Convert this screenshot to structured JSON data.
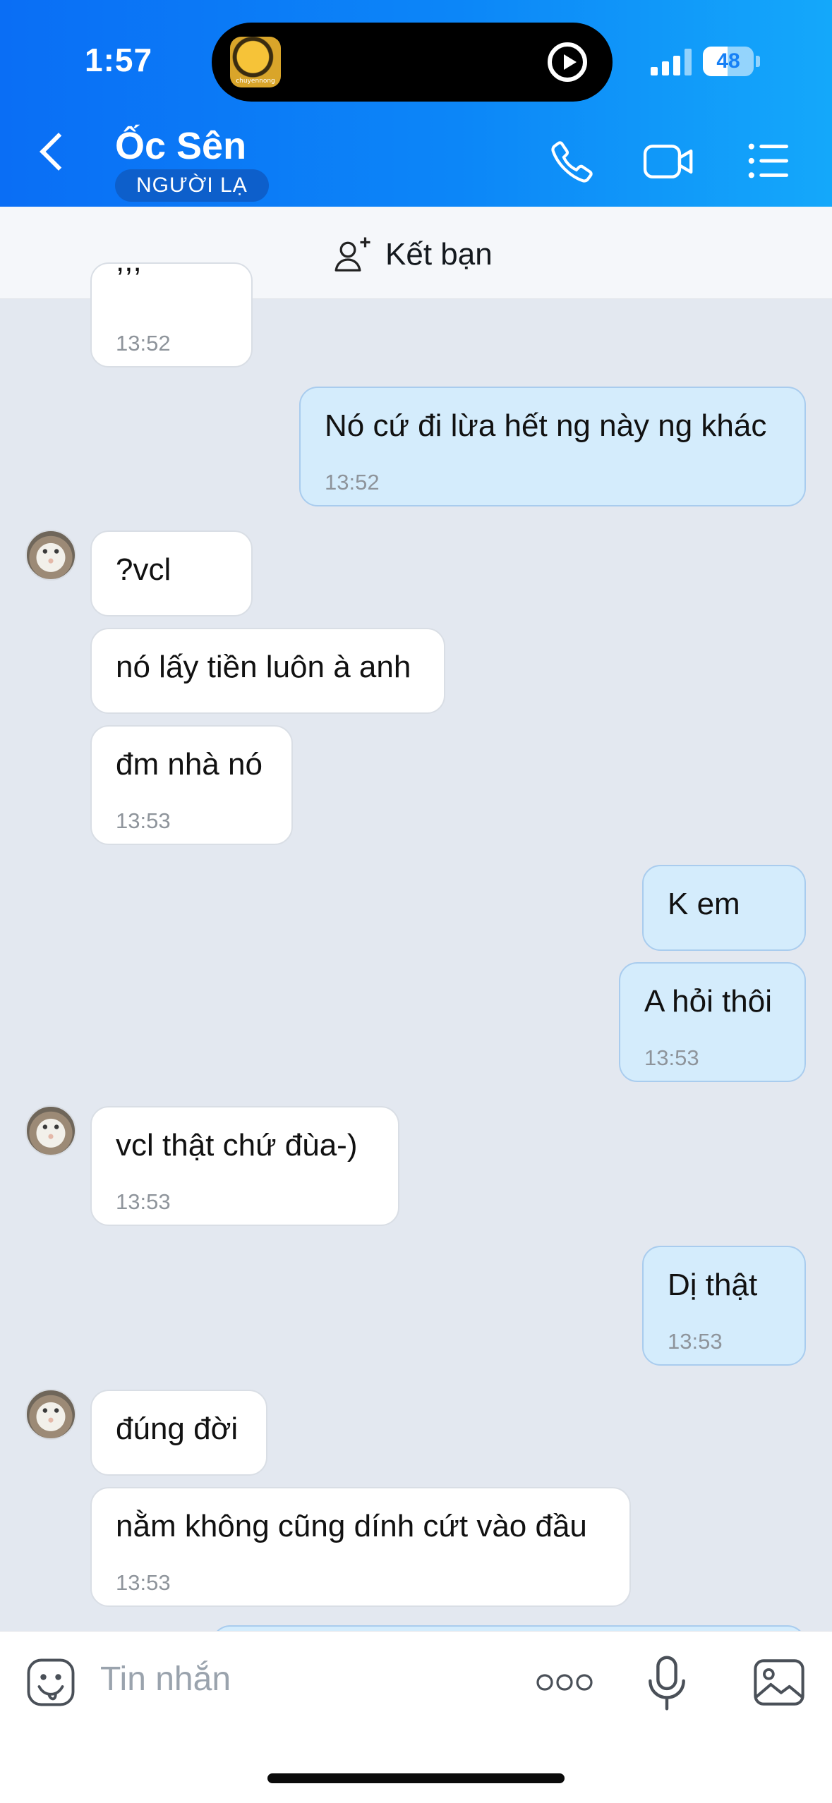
{
  "status_bar": {
    "time": "1:57",
    "battery_level": "48",
    "battery_fraction": 0.48,
    "now_playing_art_text": "chuyennong",
    "icons": [
      "play-circle-icon",
      "signal-icon",
      "battery-icon"
    ]
  },
  "header": {
    "contact_name": "Ốc Sên",
    "badge": "NGƯỜI LẠ",
    "icons": [
      "back-chevron-icon",
      "phone-icon",
      "video-call-icon",
      "list-menu-icon"
    ]
  },
  "add_friend": {
    "label": "Kết bạn",
    "icon": "add-user-icon"
  },
  "messages": [
    {
      "side": "in",
      "text": ";;;",
      "time": "13:52"
    },
    {
      "side": "out",
      "text": "Nó cứ đi lừa hết ng này ng khác",
      "time": "13:52"
    },
    {
      "side": "in",
      "text": "?vcl",
      "avatar": true
    },
    {
      "side": "in",
      "text": "nó lấy tiền luôn à anh"
    },
    {
      "side": "in",
      "text": "đm nhà nó",
      "time": "13:53"
    },
    {
      "side": "out",
      "text": "K em"
    },
    {
      "side": "out",
      "text": "A hỏi thôi",
      "time": "13:53"
    },
    {
      "side": "in",
      "text": "vcl thật chứ đùa-)",
      "time": "13:53",
      "avatar": true
    },
    {
      "side": "out",
      "text": "Dị thật",
      "time": "13:53"
    },
    {
      "side": "in",
      "text": "đúng đời",
      "avatar": true
    },
    {
      "side": "in",
      "text": "nằm không cũng dính cứt vào đầu",
      "time": "13:53"
    }
  ],
  "composer": {
    "placeholder": "Tin nhắn",
    "icons": [
      "sticker-icon",
      "more-icon",
      "microphone-icon",
      "image-icon"
    ]
  },
  "colors": {
    "header_start": "#0a6ef5",
    "header_end": "#14a8fa",
    "chat_background": "#e3e8f0",
    "incoming_bubble": "#ffffff",
    "outgoing_bubble": "#d4ecfc"
  }
}
